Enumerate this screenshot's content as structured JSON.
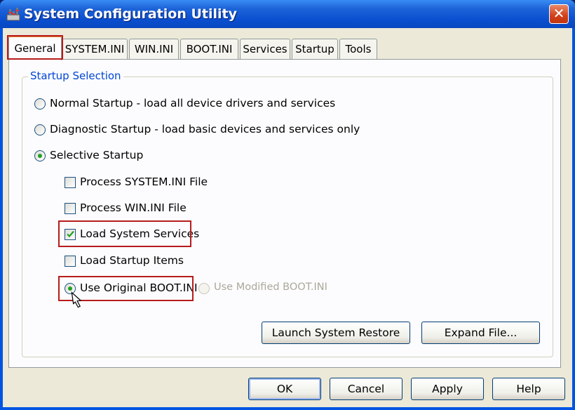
{
  "window": {
    "title": "System Configuration Utility",
    "close_glyph": "✕"
  },
  "tabs": [
    {
      "label": "General",
      "active": true
    },
    {
      "label": "SYSTEM.INI"
    },
    {
      "label": "WIN.INI"
    },
    {
      "label": "BOOT.INI"
    },
    {
      "label": "Services"
    },
    {
      "label": "Startup"
    },
    {
      "label": "Tools"
    }
  ],
  "startup_selection": {
    "legend": "Startup Selection",
    "normal": "Normal Startup - load all device drivers and services",
    "diagnostic": "Diagnostic Startup - load basic devices and services only",
    "selective": "Selective Startup",
    "selected_mode": "selective",
    "process_system_ini": {
      "label": "Process SYSTEM.INI File",
      "checked": false
    },
    "process_win_ini": {
      "label": "Process WIN.INI File",
      "checked": false
    },
    "load_system_services": {
      "label": "Load System Services",
      "checked": true
    },
    "load_startup_items": {
      "label": "Load Startup Items",
      "checked": false
    },
    "use_original_boot": {
      "label": "Use Original BOOT.INI",
      "selected": true
    },
    "use_modified_boot": {
      "label": "Use Modified BOOT.INI",
      "enabled": false
    }
  },
  "panel_buttons": {
    "launch_restore": "Launch System Restore",
    "expand_file": "Expand File..."
  },
  "dialog_buttons": {
    "ok": "OK",
    "cancel": "Cancel",
    "apply": "Apply",
    "help": "Help"
  },
  "colors": {
    "highlight_box": "#b71c1c",
    "legend_text": "#0046d5",
    "title_bar": "#0a4fd0"
  },
  "icons": [
    "app-icon",
    "close-icon",
    "checkmark-icon",
    "mouse-cursor-icon"
  ]
}
